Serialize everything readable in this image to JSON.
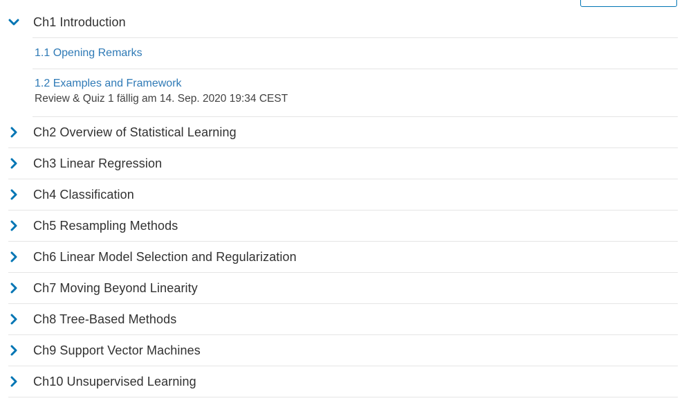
{
  "outline": {
    "chapter1": {
      "title": "Ch1 Introduction",
      "icon": "chevron-down-icon",
      "subsections": [
        {
          "title": "1.1 Opening Remarks"
        },
        {
          "title": "1.2 Examples and Framework",
          "due": "Review & Quiz 1 fällig am 14. Sep. 2020 19:34 CEST"
        }
      ]
    },
    "chapters": [
      {
        "title": "Ch2 Overview of Statistical Learning"
      },
      {
        "title": "Ch3 Linear Regression"
      },
      {
        "title": "Ch4 Classification"
      },
      {
        "title": "Ch5 Resampling Methods"
      },
      {
        "title": "Ch6 Linear Model Selection and Regularization"
      },
      {
        "title": "Ch7 Moving Beyond Linearity"
      },
      {
        "title": "Ch8 Tree-Based Methods"
      },
      {
        "title": "Ch9 Support Vector Machines"
      },
      {
        "title": "Ch10 Unsupervised Learning"
      }
    ],
    "colors": {
      "accent": "#0075b4",
      "link": "#2f7ab6",
      "text": "#313131",
      "divider": "#e5e5e5"
    }
  }
}
